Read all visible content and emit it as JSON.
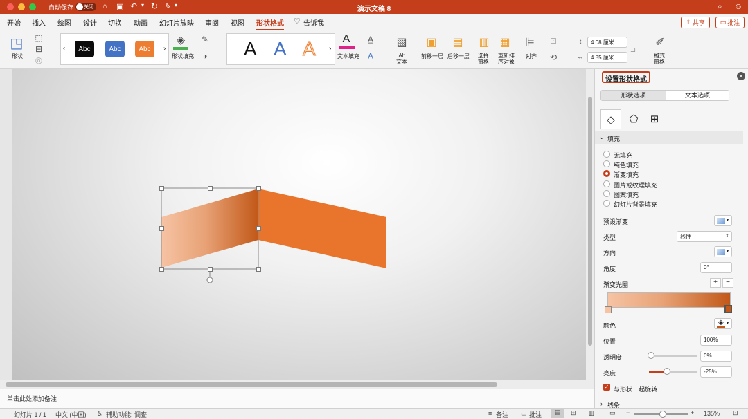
{
  "titlebar": {
    "autosave_label": "自动保存",
    "autosave_state": "关闭",
    "doc_title": "演示文稿 8"
  },
  "tabs": [
    "开始",
    "插入",
    "绘图",
    "设计",
    "切换",
    "动画",
    "幻灯片放映",
    "审阅",
    "视图",
    "形状格式",
    "告诉我"
  ],
  "active_tab": "形状格式",
  "share_button": "共享",
  "comment_button": "批注",
  "ribbon": {
    "shapes_label": "形状",
    "style_gallery": [
      "Abc",
      "Abc",
      "Abc"
    ],
    "style_colors": [
      "#0c0c0c",
      "#4472c4",
      "#ed7d31"
    ],
    "shape_fill_label": "形状填充",
    "wordart": [
      "A",
      "A",
      "A"
    ],
    "text_fill_label": "文本填充",
    "alt_text_label": "Alt\n文本",
    "bring_forward_label": "前移一层",
    "send_backward_label": "后移一层",
    "selection_pane_label": "选择\n窗格",
    "reorder_label": "重新排\n序对象",
    "align_label": "对齐",
    "height_value": "4.08 厘米",
    "width_value": "4.85 厘米",
    "format_pane_label": "格式\n窗格"
  },
  "pane": {
    "title": "设置形状格式",
    "tab_shape": "形状选项",
    "tab_text": "文本选项",
    "fill_section": "填充",
    "fill_options": [
      "无填充",
      "纯色填充",
      "渐变填充",
      "图片或纹理填充",
      "图案填充",
      "幻灯片背景填充"
    ],
    "selected_fill": "渐变填充",
    "preset_label": "预设渐变",
    "type_label": "类型",
    "type_value": "线性",
    "direction_label": "方向",
    "angle_label": "角度",
    "angle_value": "0°",
    "stops_label": "渐变光圈",
    "color_label": "颜色",
    "position_label": "位置",
    "position_value": "100%",
    "transparency_label": "透明度",
    "transparency_value": "0%",
    "brightness_label": "亮度",
    "brightness_value": "-25%",
    "rotate_label": "与形状一起旋转",
    "line_section": "线条",
    "gradient_colors": [
      "#f6c3a3",
      "#c25818"
    ]
  },
  "notes_placeholder": "单击此处添加备注",
  "status": {
    "slide": "幻灯片 1 / 1",
    "language": "中文 (中国)",
    "accessibility": "辅助功能: 调查",
    "notes": "备注",
    "comments": "批注",
    "zoom": "135%"
  },
  "colors": {
    "accent": "#c43e1c",
    "orange": "#e9742b"
  }
}
